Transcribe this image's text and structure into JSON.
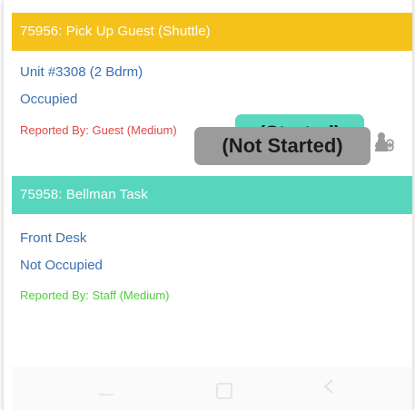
{
  "tasks": [
    {
      "header": "75956: Pick Up Guest (Shuttle)",
      "header_color": "#f5c21c",
      "location": "Unit #3308 (2 Bdrm)",
      "occupancy": "Occupied",
      "reported": "Reported By: Guest  (Medium)",
      "reported_color": "#e04848",
      "status": "(Started)",
      "status_color": "#5ad7bd",
      "action_icon": "assign-user-icon"
    },
    {
      "header": "75958: Bellman Task",
      "header_color": "#58d6bd",
      "location": "Front Desk",
      "occupancy": "Not Occupied",
      "reported": "Reported By: Staff  (Medium)",
      "reported_color": "#52cc3c",
      "status": "(Not Started)",
      "status_color": "#9b9b9b",
      "action_icon": "assign-user-icon"
    }
  ],
  "nav": {
    "icons": [
      "recent-apps-icon",
      "home-icon",
      "back-icon"
    ]
  }
}
